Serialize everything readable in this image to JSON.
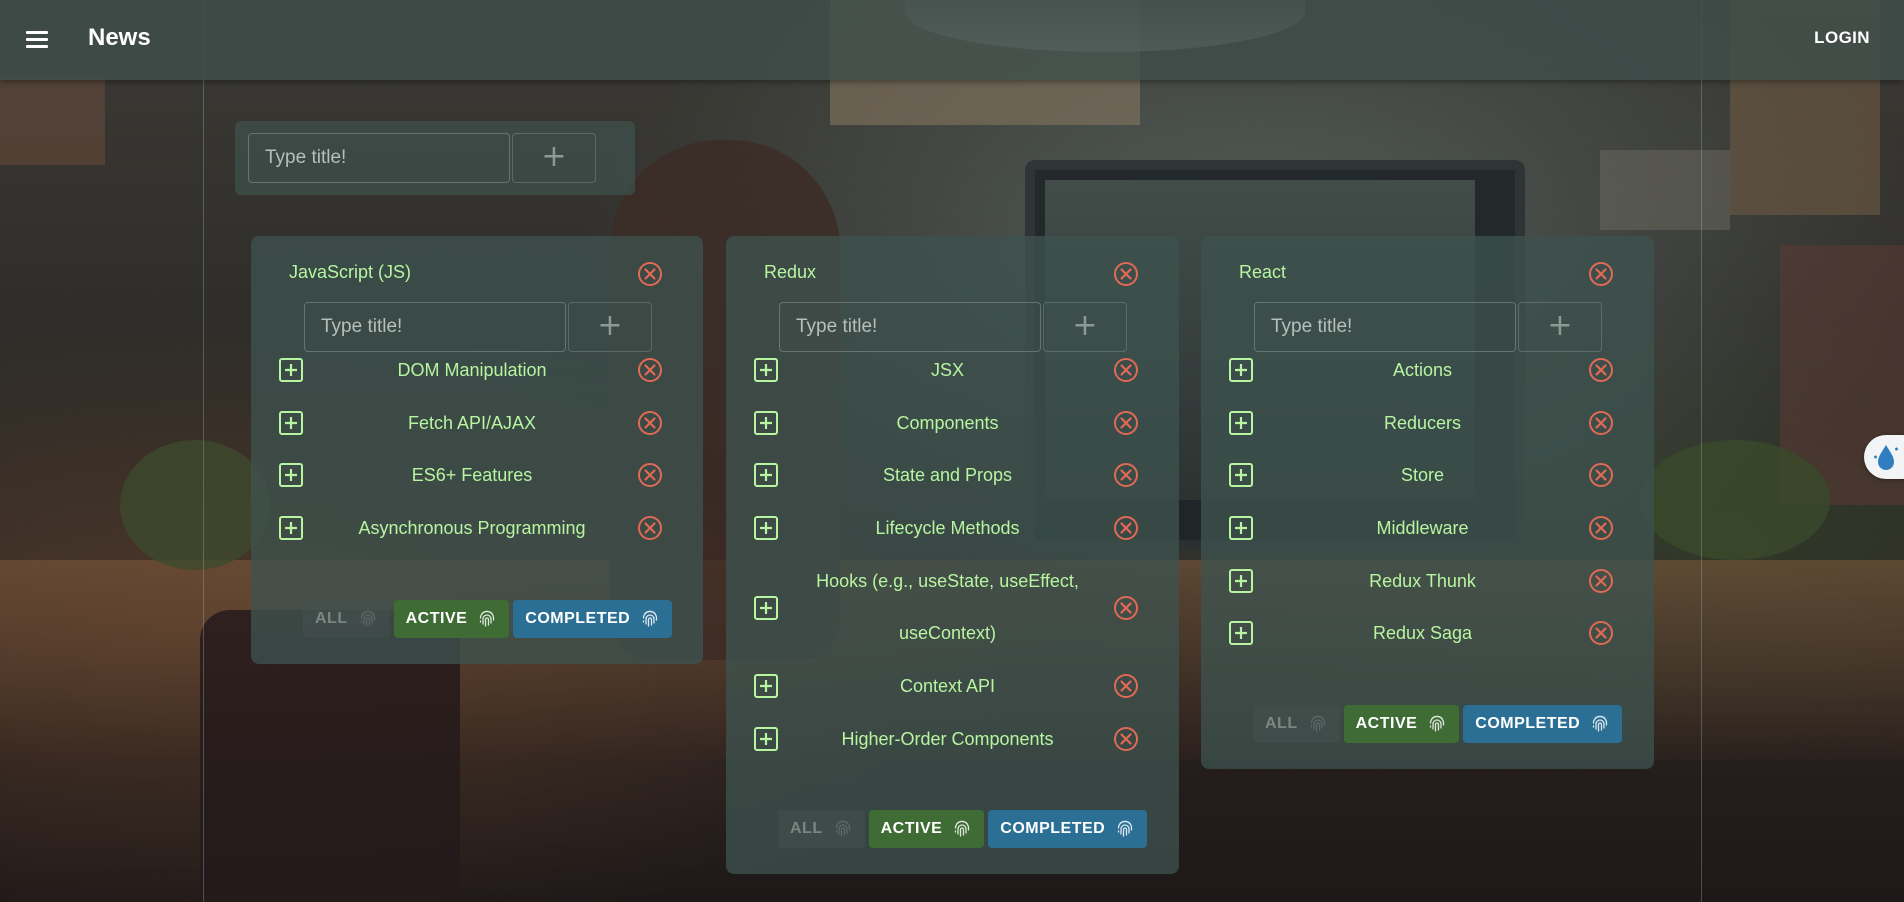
{
  "appbar": {
    "title": "News",
    "login_label": "LOGIN"
  },
  "new_list_form": {
    "placeholder": "Type title!",
    "add_label": "+"
  },
  "lists": [
    {
      "title": "JavaScript (JS)",
      "input_placeholder": "Type title!",
      "add_label": "+",
      "tasks": [
        "DOM Manipulation",
        "Fetch API/AJAX",
        "ES6+ Features",
        "Asynchronous Programming"
      ],
      "filters": [
        "ALL",
        "ACTIVE",
        "COMPLETED"
      ]
    },
    {
      "title": "Redux",
      "input_placeholder": "Type title!",
      "add_label": "+",
      "tasks": [
        "JSX",
        "Components",
        "State and Props",
        "Lifecycle Methods",
        "Hooks (e.g., useState, useEffect, useContext)",
        "Context API",
        "Higher-Order Components"
      ],
      "filters": [
        "ALL",
        "ACTIVE",
        "COMPLETED"
      ]
    },
    {
      "title": "React",
      "input_placeholder": "Type title!",
      "add_label": "+",
      "tasks": [
        "Actions",
        "Reducers",
        "Store",
        "Middleware",
        "Redux Thunk",
        "Redux Saga"
      ],
      "filters": [
        "ALL",
        "ACTIVE",
        "COMPLETED"
      ]
    }
  ],
  "colors": {
    "accent_text": "#b7f5a1",
    "delete_icon": "#e06a55",
    "active_filter": "#3f6b35",
    "completed_filter": "#2b6f95"
  },
  "icons": {
    "menu": "menu-icon",
    "delete": "close-circle-icon",
    "add_item": "plus-square-icon",
    "filter": "fingerprint-icon"
  }
}
